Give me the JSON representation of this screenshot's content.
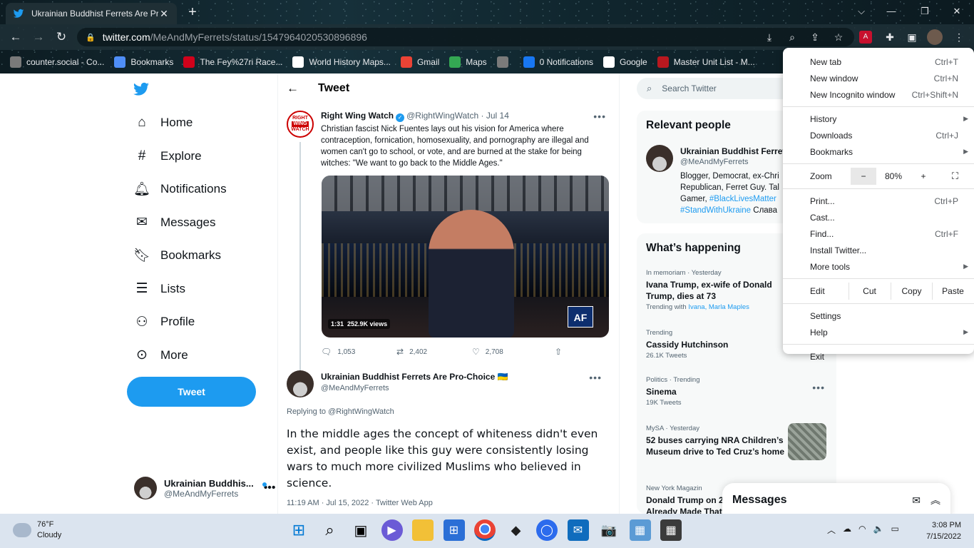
{
  "browser": {
    "tab_title": "Ukrainian Buddhist Ferrets Are Pr",
    "url_host": "twitter.com",
    "url_path": "/MeAndMyFerrets/status/1547964020530896896",
    "bookmarks": [
      {
        "label": "counter.social - Co...",
        "icon": "counter-social-icon",
        "color": "#7a7a7a"
      },
      {
        "label": "Bookmarks",
        "icon": "star-icon",
        "color": "#4f8ef7"
      },
      {
        "label": "The Fey%27ri Race...",
        "icon": "b-icon",
        "color": "#d0021b"
      },
      {
        "label": "World History Maps...",
        "icon": "wordpress-icon",
        "color": "#ffffff"
      },
      {
        "label": "Gmail",
        "icon": "gmail-icon",
        "color": "#ea4335"
      },
      {
        "label": "Maps",
        "icon": "maps-icon",
        "color": "#34a853"
      },
      {
        "label": "",
        "icon": "globe-icon",
        "color": "#7a7a7a"
      },
      {
        "label": "0 Notifications",
        "icon": "facebook-icon",
        "color": "#1877f2"
      },
      {
        "label": "Google",
        "icon": "google-icon",
        "color": "#ffffff"
      },
      {
        "label": "Master Unit List - M...",
        "icon": "unit-list-icon",
        "color": "#b8181f"
      }
    ]
  },
  "chrome_menu": {
    "items1": [
      {
        "label": "New tab",
        "shortcut": "Ctrl+T"
      },
      {
        "label": "New window",
        "shortcut": "Ctrl+N"
      },
      {
        "label": "New Incognito window",
        "shortcut": "Ctrl+Shift+N"
      }
    ],
    "items2": [
      {
        "label": "History",
        "shortcut": "",
        "submenu": true
      },
      {
        "label": "Downloads",
        "shortcut": "Ctrl+J",
        "submenu": false
      },
      {
        "label": "Bookmarks",
        "shortcut": "",
        "submenu": true
      }
    ],
    "zoom_label": "Zoom",
    "zoom_minus": "−",
    "zoom_value": "80%",
    "zoom_plus": "+",
    "items3": [
      {
        "label": "Print...",
        "shortcut": "Ctrl+P",
        "submenu": false
      },
      {
        "label": "Cast...",
        "shortcut": "",
        "submenu": false
      },
      {
        "label": "Find...",
        "shortcut": "Ctrl+F",
        "submenu": false
      },
      {
        "label": "Install Twitter...",
        "shortcut": "",
        "submenu": false
      },
      {
        "label": "More tools",
        "shortcut": "",
        "submenu": true
      }
    ],
    "edit_label": "Edit",
    "cut_label": "Cut",
    "copy_label": "Copy",
    "paste_label": "Paste",
    "items4": [
      {
        "label": "Settings",
        "submenu": false
      },
      {
        "label": "Help",
        "submenu": true
      }
    ],
    "exit_label": "Exit"
  },
  "nav": {
    "items": [
      {
        "label": "Home",
        "icon": "home-icon"
      },
      {
        "label": "Explore",
        "icon": "hashtag-icon"
      },
      {
        "label": "Notifications",
        "icon": "bell-icon"
      },
      {
        "label": "Messages",
        "icon": "envelope-icon"
      },
      {
        "label": "Bookmarks",
        "icon": "bookmark-icon"
      },
      {
        "label": "Lists",
        "icon": "list-icon"
      },
      {
        "label": "Profile",
        "icon": "person-icon"
      },
      {
        "label": "More",
        "icon": "more-circle-icon"
      }
    ],
    "tweet_button": "Tweet",
    "account_name": "Ukrainian Buddhis...",
    "account_handle": "@MeAndMyFerrets"
  },
  "main": {
    "header": "Tweet",
    "original": {
      "avatar_text": [
        "RIGHT",
        "WING",
        "WATCH"
      ],
      "name": "Right Wing Watch",
      "handle": "@RightWingWatch",
      "date": "· Jul 14",
      "text": "Christian fascist Nick Fuentes lays out his vision for America where contraception, fornication, homosexuality, and pornography are illegal and women can't go to school, or vote, and are burned at the stake for being witches: \"We want to go back to the Middle Ages.\"",
      "video_time": "1:31",
      "video_views": "252.9K views",
      "video_logo": "AF",
      "replies": "1,053",
      "retweets": "2,402",
      "likes": "2,708"
    },
    "reply": {
      "name": "Ukrainian Buddhist Ferrets Are Pro-Choice 🇺🇦",
      "handle": "@MeAndMyFerrets",
      "replying_to": "Replying to @RightWingWatch",
      "text": "In the middle ages the concept of whiteness didn't even exist, and people like this guy were consistently losing wars to much more civilized Muslims who believed in science.",
      "timestamp": "11:19 AM · Jul 15, 2022 · Twitter Web App"
    }
  },
  "right": {
    "search_placeholder": "Search Twitter",
    "relevant_title": "Relevant people",
    "relevant_name": "Ukrainian Buddhist Ferret",
    "relevant_handle": "@MeAndMyFerrets",
    "bio_1": "Blogger, Democrat, ex-Chri",
    "bio_2": "Republican, Ferret Guy. Tal",
    "bio_3": "Gamer, ",
    "bio_tag1": "#BlackLivesMatter",
    "bio_tag2": "#StandWithUkraine",
    "bio_4": " Слава",
    "happening_title": "What’s happening",
    "trends": [
      {
        "context": "In memoriam · Yesterday",
        "title": "Ivana Trump, ex-wife of Donald Trump, dies at 73",
        "sub_prefix": "Trending with ",
        "sub_links": "Ivana, Marla Maples"
      },
      {
        "context": "Trending",
        "title": "Cassidy Hutchinson",
        "sub": "26.1K Tweets"
      },
      {
        "context": "Politics · Trending",
        "title": "Sinema",
        "sub": "19K Tweets"
      },
      {
        "context": "MySA · Yesterday",
        "title": "52 buses carrying NRA Children’s Museum drive to Ted Cruz’s home"
      },
      {
        "context": "New York Magazin",
        "title": "Donald Trump on 2",
        "title2": "Already Made That"
      }
    ],
    "messages_label": "Messages"
  },
  "taskbar": {
    "temp": "76°F",
    "condition": "Cloudy",
    "time": "3:08 PM",
    "date": "7/15/2022"
  }
}
